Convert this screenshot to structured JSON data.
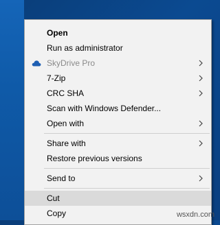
{
  "menu": {
    "items": [
      {
        "label": "Open",
        "style": "bold"
      },
      {
        "label": "Run as administrator"
      },
      {
        "label": "SkyDrive Pro",
        "disabled": true,
        "icon": "cloud-icon",
        "submenu": true
      },
      {
        "label": "7-Zip",
        "submenu": true
      },
      {
        "label": "CRC SHA",
        "submenu": true
      },
      {
        "label": "Scan with Windows Defender..."
      },
      {
        "label": "Open with",
        "submenu": true
      },
      {
        "label": "Share with",
        "submenu": true
      },
      {
        "label": "Restore previous versions"
      },
      {
        "label": "Send to",
        "submenu": true
      },
      {
        "label": "Cut",
        "highlighted": true
      },
      {
        "label": "Copy"
      }
    ]
  },
  "watermark": "wsxdn.com",
  "colors": {
    "desktop": "#0b4a91",
    "menu_bg": "#f2f2f2",
    "highlight": "#dadada",
    "disabled_text": "#8a8a8a",
    "cloud_icon": "#1e5fb3"
  }
}
